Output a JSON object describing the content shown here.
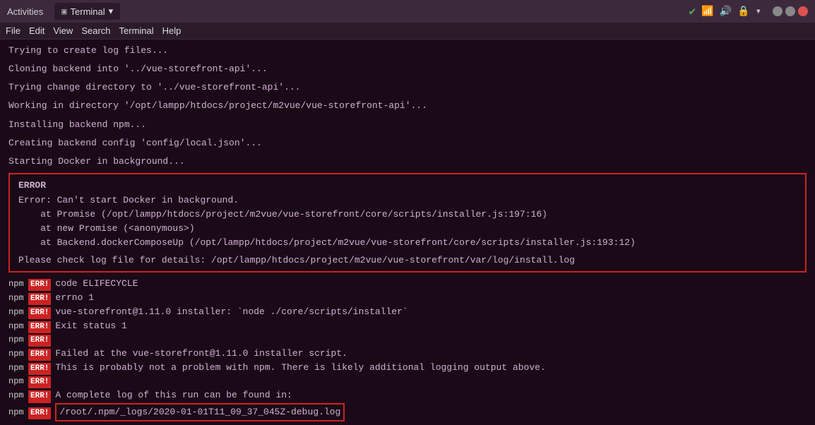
{
  "titlebar": {
    "activities": "Activities",
    "terminal_tab": "Terminal",
    "terminal_arrow": "▾"
  },
  "menubar": {
    "items": [
      "File",
      "Edit",
      "View",
      "Search",
      "Terminal",
      "Help"
    ]
  },
  "terminal": {
    "lines": [
      "Trying to create log files...",
      "",
      "Cloning backend into '../vue-storefront-api'...",
      "",
      "Trying change directory to '../vue-storefront-api'...",
      "",
      "Working in directory '/opt/lampp/htdocs/project/m2vue/vue-storefront-api'...",
      "",
      "Installing backend npm...",
      "",
      "Creating backend config 'config/local.json'...",
      "",
      "Starting Docker in background..."
    ],
    "error_box": {
      "title": "ERROR",
      "lines": [
        "Error: Can't start Docker in background.",
        "    at Promise (/opt/lampp/htdocs/project/m2vue/vue-storefront/core/scripts/installer.js:197:16)",
        "    at new Promise (<anonymous>)",
        "    at Backend.dockerComposeUp (/opt/lampp/htdocs/project/m2vue/vue-storefront/core/scripts/installer.js:193:12)"
      ],
      "note": "Please check log file for details: /opt/lampp/htdocs/project/m2vue/vue-storefront/var/log/install.log"
    },
    "npm_lines": [
      {
        "label": "npm",
        "err": "ERR!",
        "text": "code ELIFECYCLE"
      },
      {
        "label": "npm",
        "err": "ERR!",
        "text": "errno 1"
      },
      {
        "label": "npm",
        "err": "ERR!",
        "text": "vue-storefront@1.11.0 installer: `node ./core/scripts/installer`"
      },
      {
        "label": "npm",
        "err": "ERR!",
        "text": "Exit status 1"
      },
      {
        "label": "npm",
        "err": "ERR!",
        "text": ""
      },
      {
        "label": "npm",
        "err": "ERR!",
        "text": "Failed at the vue-storefront@1.11.0 installer script."
      },
      {
        "label": "npm",
        "err": "ERR!",
        "text": "This is probably not a problem with npm. There is likely additional logging output above."
      },
      {
        "label": "npm",
        "err": "ERR!",
        "text": ""
      },
      {
        "label": "npm",
        "err": "ERR!",
        "text": "A complete log of this run can be found in:"
      },
      {
        "label": "npm",
        "err": "ERR!",
        "text": "/root/.npm/_logs/2020-01-01T11_09_37_045Z-debug.log",
        "highlight": true
      }
    ]
  }
}
